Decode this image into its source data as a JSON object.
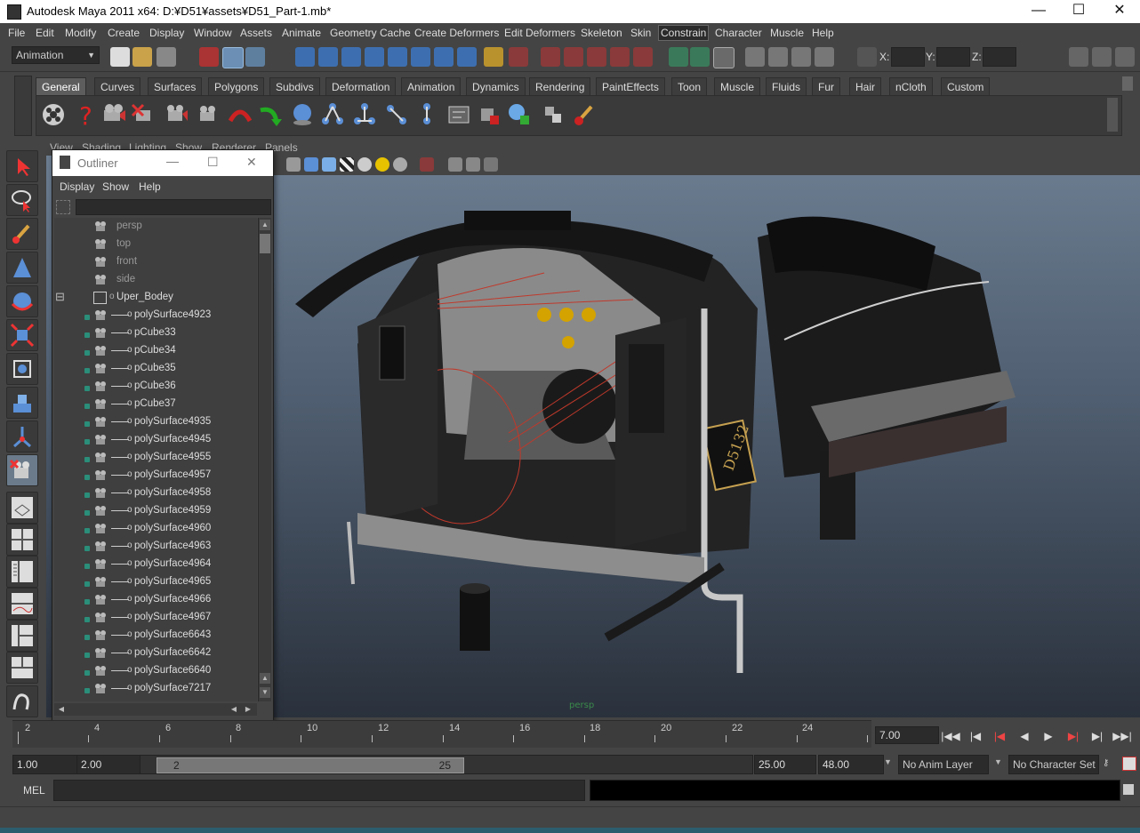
{
  "window": {
    "title": "Autodesk Maya 2011 x64: D:¥D51¥assets¥D51_Part-1.mb*",
    "minimize": "—",
    "maximize": "☐",
    "close": "✕"
  },
  "menubar": [
    "File",
    "Edit",
    "Modify",
    "Create",
    "Display",
    "Window",
    "Assets",
    "Animate",
    "Geometry Cache",
    "Create Deformers",
    "Edit Deformers",
    "Skeleton",
    "Skin",
    "Constrain",
    "Character",
    "Muscle",
    "Help"
  ],
  "menubar_active": "Constrain",
  "statusline": {
    "mode": "Animation",
    "x_label": "X:",
    "y_label": "Y:",
    "z_label": "Z:"
  },
  "shelf_tabs": [
    "General",
    "Curves",
    "Surfaces",
    "Polygons",
    "Subdivs",
    "Deformation",
    "Animation",
    "Dynamics",
    "Rendering",
    "PaintEffects",
    "Toon",
    "Muscle",
    "Fluids",
    "Fur",
    "Hair",
    "nCloth",
    "Custom"
  ],
  "shelf_selected": "General",
  "viewport": {
    "menu": [
      "View",
      "Shading",
      "Lighting",
      "Show",
      "Renderer",
      "Panels"
    ],
    "camera_label": "persp",
    "model_label": "D5132"
  },
  "outliner": {
    "title": "Outliner",
    "menu": [
      "Display",
      "Show",
      "Help"
    ],
    "cameras": [
      "persp",
      "top",
      "front",
      "side"
    ],
    "group": "Uper_Bodey",
    "expand_symbol": "⊟",
    "children": [
      "polySurface4923",
      "pCube33",
      "pCube34",
      "pCube35",
      "pCube36",
      "pCube37",
      "polySurface4935",
      "polySurface4945",
      "polySurface4955",
      "polySurface4957",
      "polySurface4958",
      "polySurface4959",
      "polySurface4960",
      "polySurface4963",
      "polySurface4964",
      "polySurface4965",
      "polySurface4966",
      "polySurface4967",
      "polySurface6643",
      "polySurface6642",
      "polySurface6640",
      "polySurface7217"
    ]
  },
  "timeslider": {
    "ticks": [
      "2",
      "4",
      "6",
      "8",
      "10",
      "12",
      "14",
      "16",
      "18",
      "20",
      "22",
      "24"
    ],
    "current_time": "7.00"
  },
  "rangeslider": {
    "start": "1.00",
    "playback_start": "2.00",
    "range_start_label": "2",
    "range_end_label": "25",
    "playback_end": "25.00",
    "end": "48.00",
    "anim_layer": "No Anim Layer",
    "character_set": "No Character Set"
  },
  "cmdline": {
    "label": "MEL"
  },
  "colors": {
    "accent_selected": "#5d5d5d",
    "outliner_eye": "#2a8e7a",
    "viewport_top": "#6e7f93",
    "viewport_bottom": "#2a313c"
  }
}
